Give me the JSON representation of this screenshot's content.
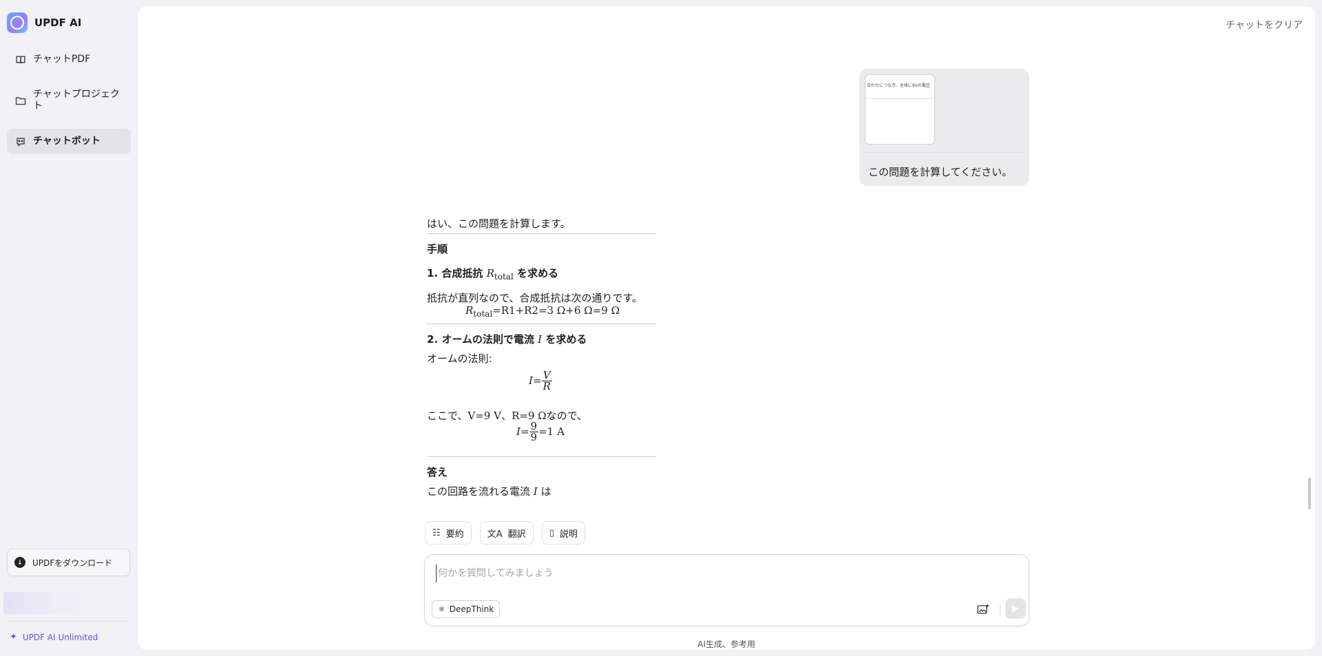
{
  "app": {
    "name": "UPDF AI"
  },
  "sidebar": {
    "items": [
      {
        "label": "チャットPDF",
        "icon": "book-icon",
        "active": false
      },
      {
        "label": "チャットプロジェクト",
        "icon": "folder-icon",
        "active": false
      },
      {
        "label": "チャットボット",
        "icon": "bot-icon",
        "active": true
      }
    ],
    "download_label": "UPDFをダウンロード",
    "unlimited_label": "UPDF AI Unlimited"
  },
  "header": {
    "clear_chat": "チャットをクリア"
  },
  "conversation": {
    "user_message": {
      "text": "この問題を計算してください。",
      "attachment_preview_text": "合わせにつなぎ、全体に9Vの電圧"
    },
    "answer": {
      "intro": "はい、この問題を計算します。",
      "section_title": "手順",
      "step1_title": "1. 合成抵抗",
      "step1_var": "R",
      "step1_sub": "total",
      "step1_title_tail": "を求める",
      "step1_text": "抵抗が直列なので、合成抵抗は次の通りです。",
      "step1_formula": "=R1+R2=3 Ω+6 Ω=9 Ω",
      "step2_title": "2. オームの法則で電流",
      "step2_var": "I",
      "step2_title_tail": "を求める",
      "step2_text": "オームの法則:",
      "ohm_numerator": "V",
      "ohm_denominator": "R",
      "given_prefix": "ここで、",
      "given_values": "V=9 V、R=9 Ω",
      "given_suffix": "なので、",
      "calc_numerator": "9",
      "calc_denominator": "9",
      "calc_result": "=1 A",
      "answer_title": "答え",
      "answer_text": "この回路を流れる電流",
      "answer_var": "I",
      "answer_tail": "は"
    }
  },
  "quick_actions": [
    {
      "label": "要約",
      "icon": "summary-icon"
    },
    {
      "label": "翻訳",
      "icon": "translate-icon"
    },
    {
      "label": "説明",
      "icon": "explain-icon"
    }
  ],
  "composer": {
    "placeholder": "何かを質問してみましょう",
    "deepthink_label": "DeepThink"
  },
  "footer_note": "AI生成、参考用",
  "colors": {
    "accent": "#6a4ee8",
    "panel": "#ffffff",
    "background": "#f2f1f5"
  }
}
